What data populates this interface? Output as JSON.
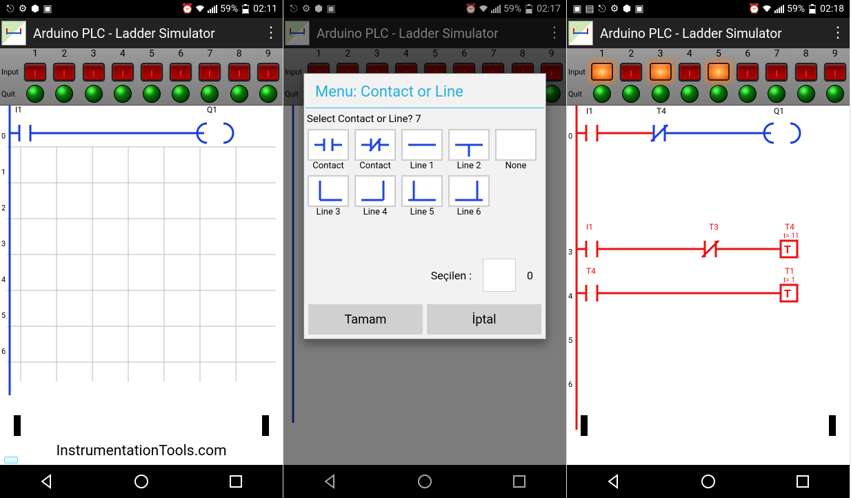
{
  "status": {
    "battery": "59%",
    "times": [
      "02:11",
      "02:17",
      "02:18"
    ]
  },
  "app": {
    "title": "Arduino PLC - Ladder Simulator"
  },
  "io": {
    "columns": [
      "1",
      "2",
      "3",
      "4",
      "5",
      "6",
      "7",
      "8",
      "9"
    ],
    "input_label": "Input",
    "quit_label": "Quit",
    "screen3_on": [
      true,
      false,
      true,
      false,
      true,
      false,
      false,
      false,
      false
    ]
  },
  "ladder": {
    "rows": [
      "0",
      "1",
      "2",
      "3",
      "4",
      "5",
      "6"
    ],
    "s1": {
      "i1": "I1",
      "q1": "Q1"
    },
    "s3": {
      "r0": {
        "i1": "I1",
        "t4": "T4",
        "q1": "Q1"
      },
      "r3": {
        "i1": "I1",
        "t3": "T3",
        "t4": "T4",
        "t4v": "t= 11"
      },
      "r4": {
        "t4": "T4",
        "t1": "T1",
        "t1v": "t= 1"
      }
    }
  },
  "dialog": {
    "title": "Menu: Contact or Line",
    "subtitle": "Select Contact or Line? 7",
    "options": [
      "Contact",
      "Contact",
      "Line 1",
      "Line 2",
      "None",
      "Line 3",
      "Line 4",
      "Line 5",
      "Line 6"
    ],
    "sel_label": "Seçilen :",
    "sel_value": "0",
    "ok": "Tamam",
    "cancel": "İptal"
  },
  "ad": {
    "text": "InstrumentationTools.com"
  }
}
